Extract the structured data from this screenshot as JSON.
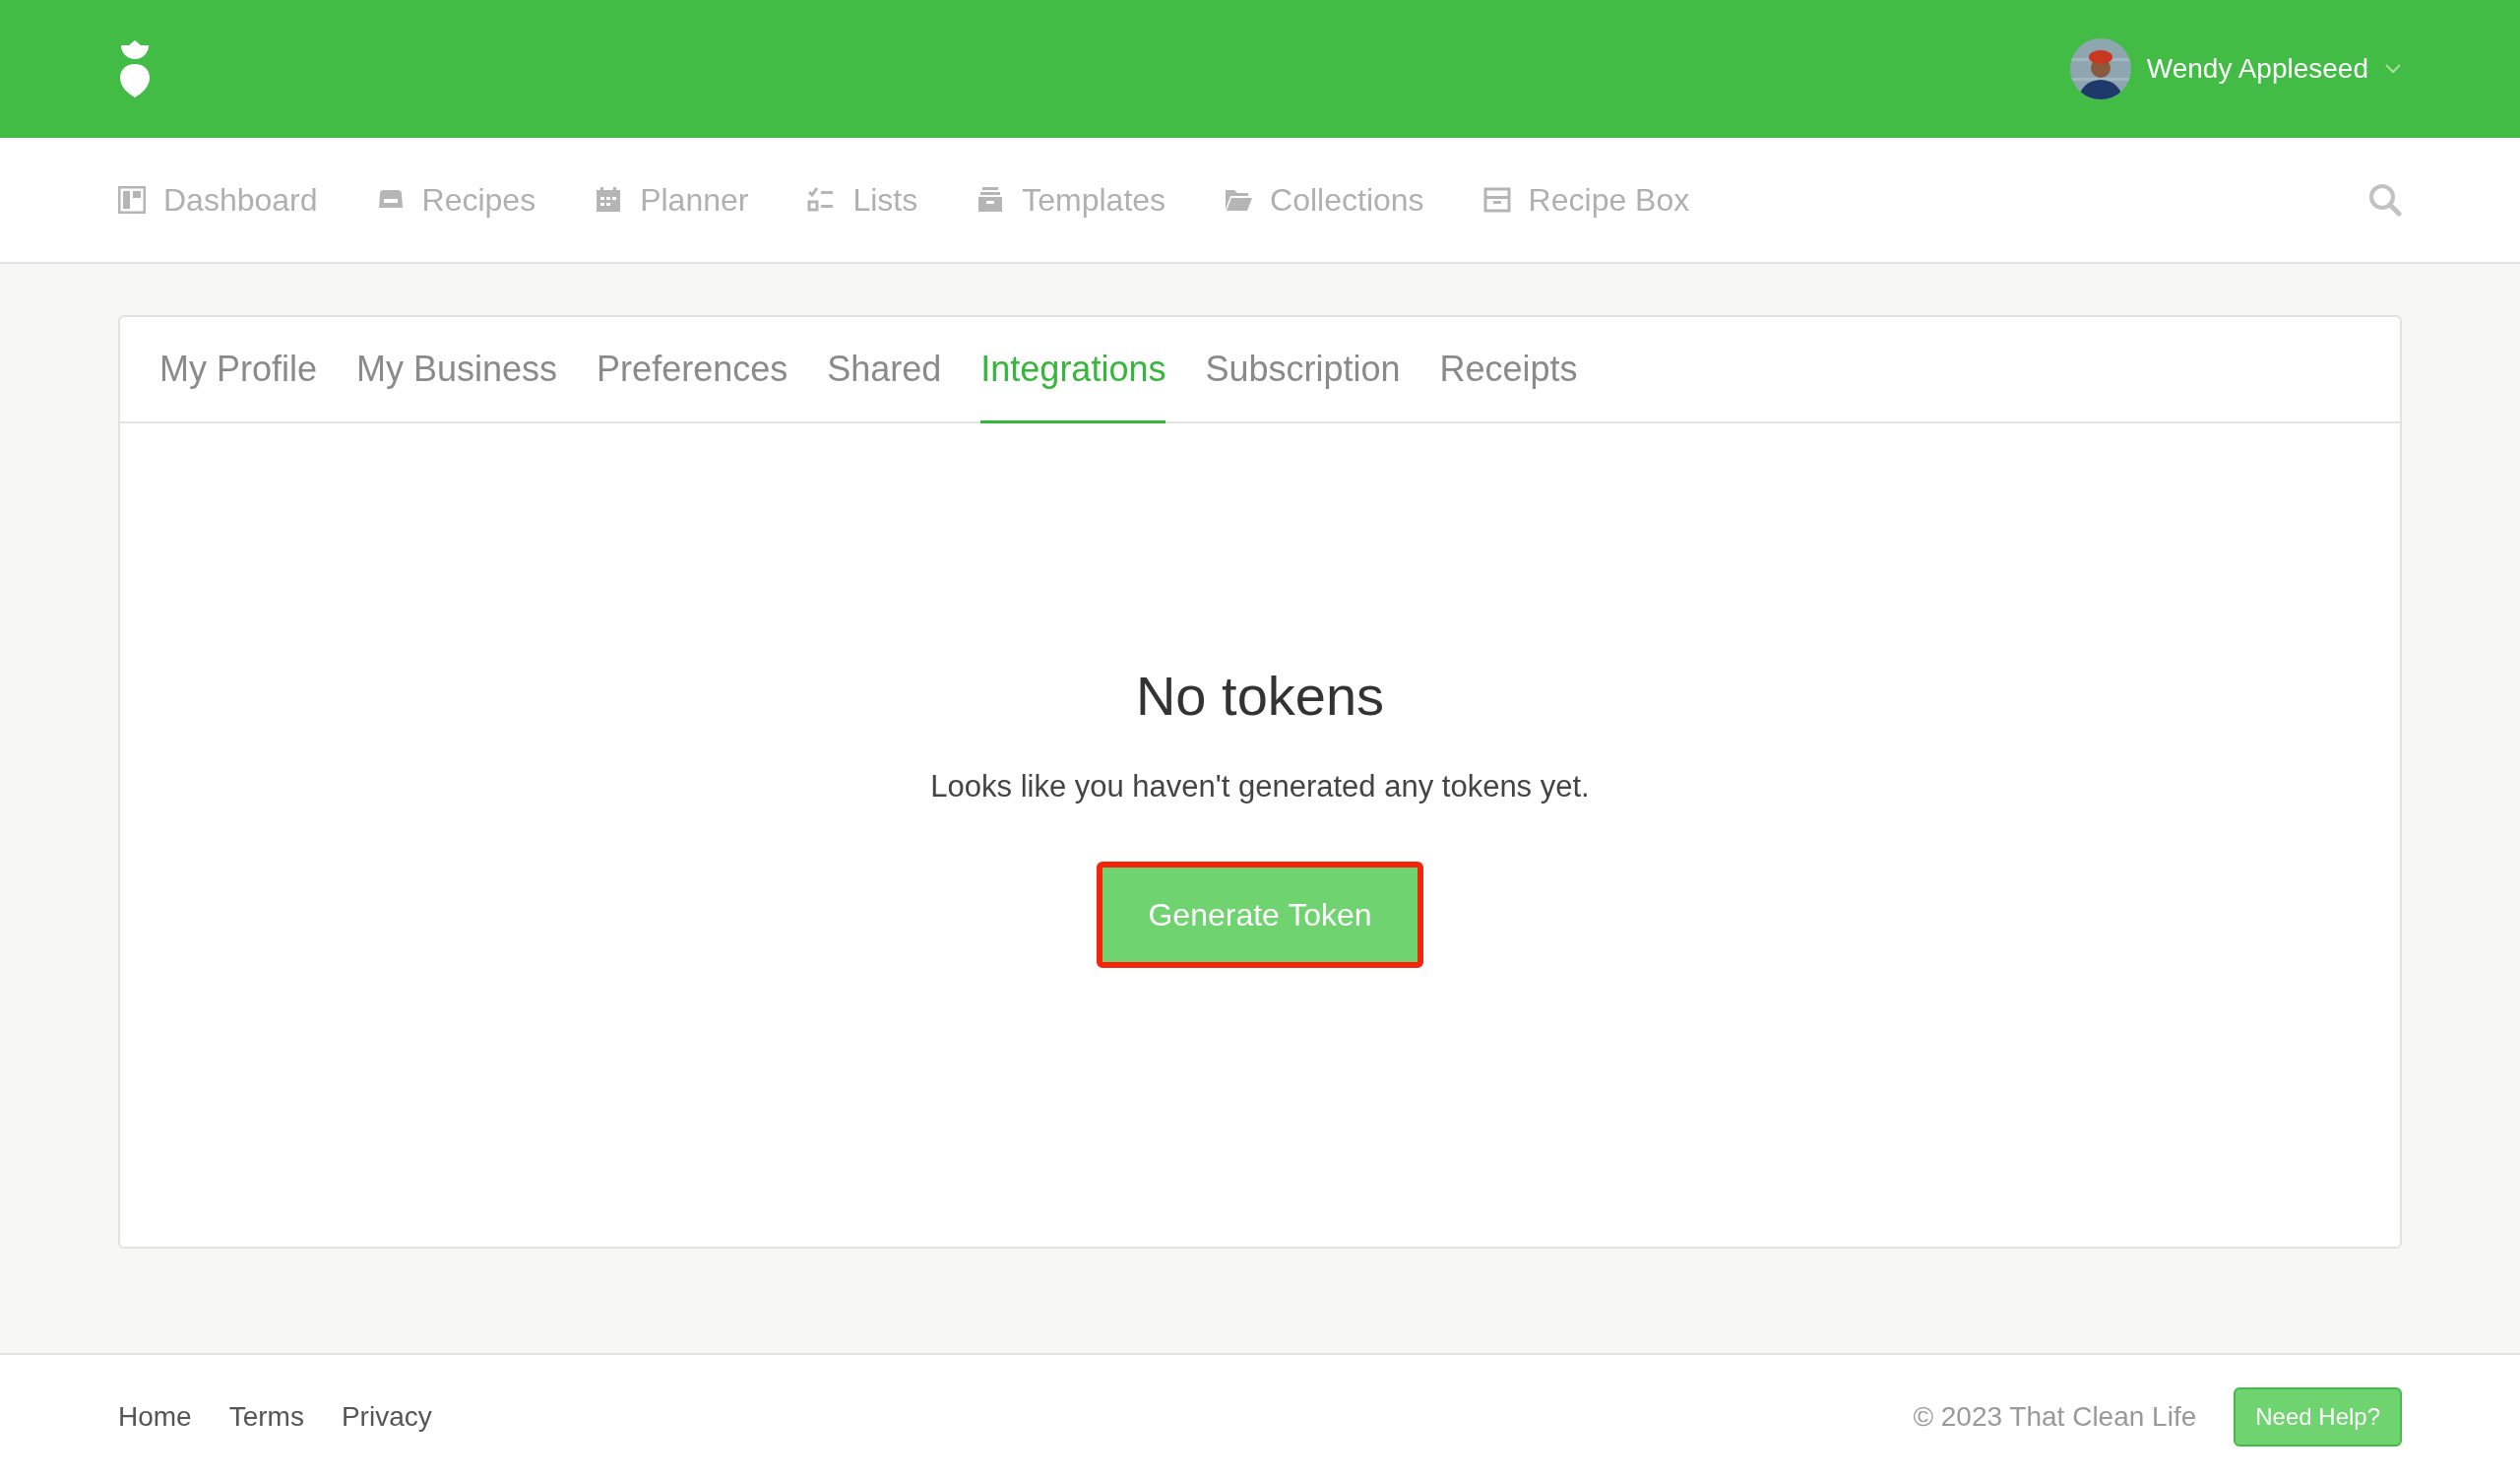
{
  "header": {
    "user_name": "Wendy Appleseed"
  },
  "nav": {
    "items": [
      {
        "label": "Dashboard"
      },
      {
        "label": "Recipes"
      },
      {
        "label": "Planner"
      },
      {
        "label": "Lists"
      },
      {
        "label": "Templates"
      },
      {
        "label": "Collections"
      },
      {
        "label": "Recipe Box"
      }
    ]
  },
  "tabs": [
    {
      "label": "My Profile",
      "selected": false
    },
    {
      "label": "My Business",
      "selected": false
    },
    {
      "label": "Preferences",
      "selected": false
    },
    {
      "label": "Shared",
      "selected": false
    },
    {
      "label": "Integrations",
      "selected": true
    },
    {
      "label": "Subscription",
      "selected": false
    },
    {
      "label": "Receipts",
      "selected": false
    }
  ],
  "empty_state": {
    "title": "No tokens",
    "message": "Looks like you haven't generated any tokens yet.",
    "button": {
      "label": "Generate Token",
      "highlighted": true
    }
  },
  "footer": {
    "links": [
      "Home",
      "Terms",
      "Privacy"
    ],
    "copyright": "© 2023 That Clean Life",
    "help_button": "Need Help?"
  }
}
